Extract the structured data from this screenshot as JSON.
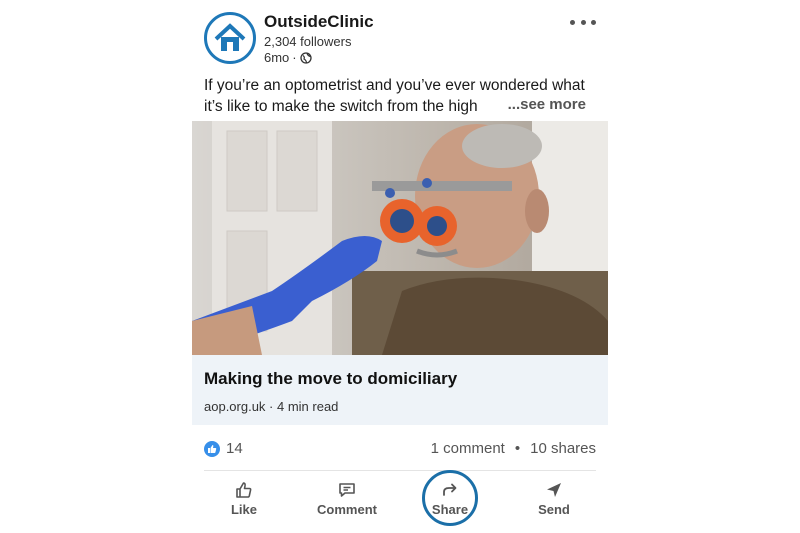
{
  "post": {
    "author": "OutsideClinic",
    "followers": "2,304 followers",
    "age": "6mo",
    "visibility_icon": "globe-icon",
    "text": "If you’re an optometrist and you’ve ever wondered what it’s like to make the switch from the high",
    "see_more": "...see more"
  },
  "link": {
    "title": "Making the move to domiciliary",
    "source": "aop.org.uk · 4 min read"
  },
  "social": {
    "reactions": "14",
    "comments": "1 comment",
    "separator": "•",
    "shares": "10 shares"
  },
  "actions": {
    "like": "Like",
    "comment": "Comment",
    "share": "Share",
    "send": "Send"
  },
  "colors": {
    "brand": "#1e78b8",
    "reaction": "#378fe9",
    "link_card_bg": "#eef3f8",
    "highlight": "#1b6fa8"
  }
}
